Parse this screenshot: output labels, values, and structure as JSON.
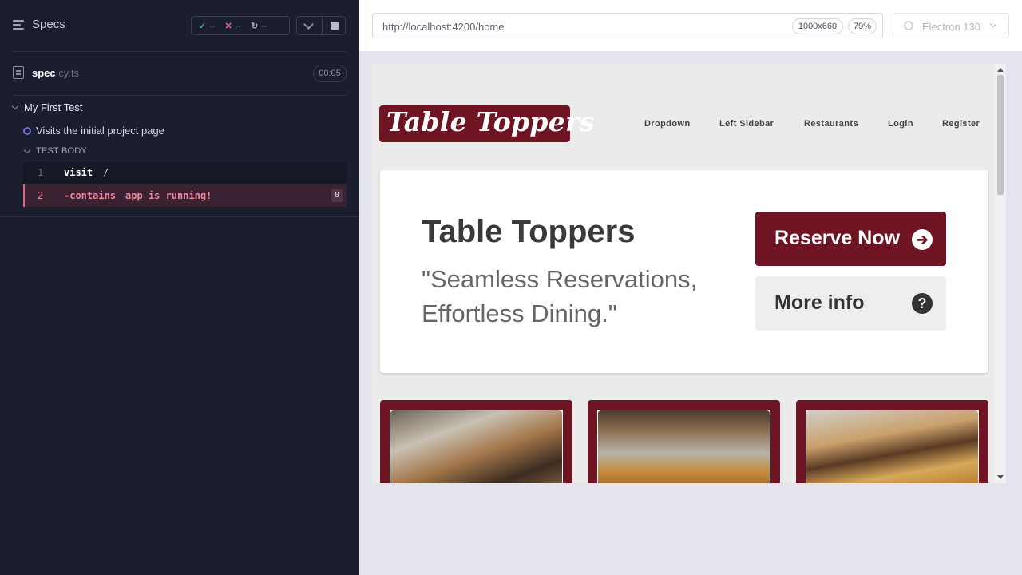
{
  "runner": {
    "title": "Specs",
    "stats": {
      "passed": "--",
      "failed": "--",
      "pending": "--"
    },
    "spec": {
      "name": "spec",
      "ext": ".cy.ts",
      "duration": "00:05"
    },
    "suite": "My First Test",
    "test": "Visits the initial project page",
    "body_label": "TEST BODY",
    "commands": [
      {
        "num": "1",
        "name": "visit",
        "message": "/"
      },
      {
        "num": "2",
        "name": "-contains",
        "message": "app is running!",
        "badge": "0"
      }
    ]
  },
  "topbar": {
    "url": "http://localhost:4200/home",
    "viewport": "1000x660",
    "zoom": "79%",
    "browser": "Electron 130"
  },
  "app": {
    "logo": "Table Toppers",
    "nav": [
      "Dropdown",
      "Left Sidebar",
      "Restaurants",
      "Login",
      "Register"
    ],
    "hero": {
      "title": "Table Toppers",
      "subtitle": "\"Seamless Reservations, Effortless Dining.\"",
      "reserve_label": "Reserve Now",
      "info_label": "More info"
    }
  },
  "colors": {
    "brand": "#6e1423",
    "runner_bg": "#1b1e2e",
    "error": "#f1889b"
  }
}
